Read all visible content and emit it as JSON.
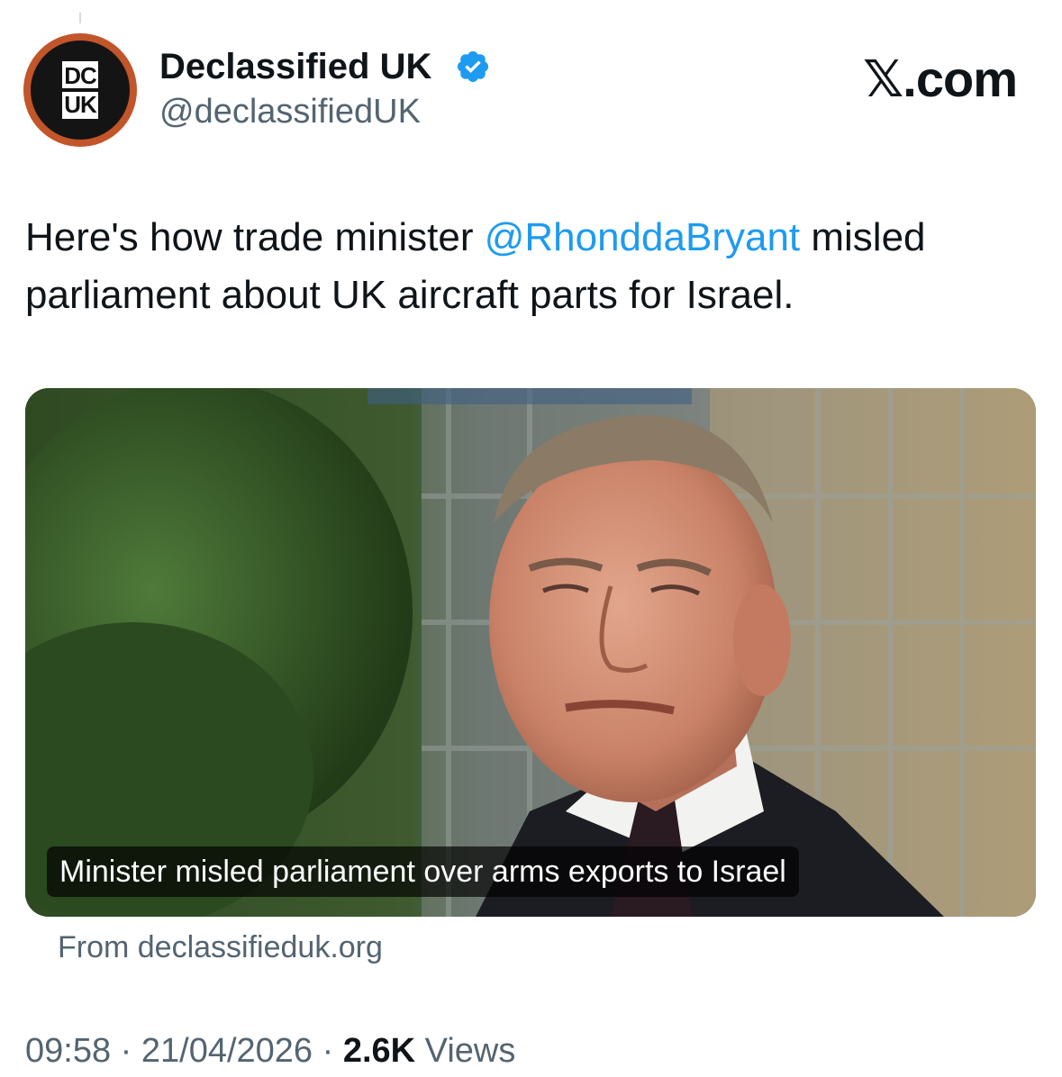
{
  "author": {
    "display_name": "Declassified UK",
    "handle": "@declassifiedUK",
    "verified": true,
    "avatar_logo_line1": "DC",
    "avatar_logo_line2": "UK"
  },
  "brand": "𝕏.com",
  "tweet": {
    "text_before": "Here's how trade minister ",
    "mention": "@RhonddaBryant",
    "text_after": " misled parliament about UK aircraft parts for Israel."
  },
  "card": {
    "headline": "Minister misled parliament over arms exports to Israel",
    "source": "From declassifieduk.org"
  },
  "meta": {
    "time": "09:58",
    "separator": " · ",
    "date": "21/04/2026",
    "views_count": "2.6K",
    "views_label": " Views"
  },
  "colors": {
    "accent": "#1d9bf0",
    "secondary_text": "#536471",
    "avatar_ring": "#c2552a"
  }
}
